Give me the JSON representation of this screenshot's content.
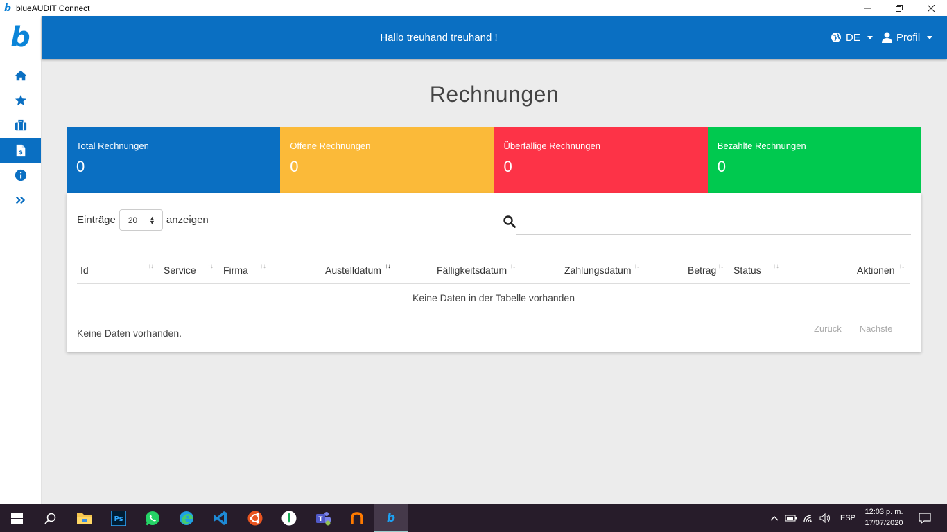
{
  "window": {
    "title": "blueAUDIT Connect",
    "logo_letter": "b"
  },
  "sidebar": {
    "brand_letter": "b",
    "items": [
      {
        "icon": "home-icon"
      },
      {
        "icon": "star-icon"
      },
      {
        "icon": "briefcase-icon"
      },
      {
        "icon": "invoice-icon",
        "active": true
      },
      {
        "icon": "info-icon"
      },
      {
        "icon": "expand-icon"
      }
    ]
  },
  "header": {
    "greeting": "Hallo treuhand treuhand !",
    "language": "DE",
    "profile": "Profil",
    "color": "#0a6fc2"
  },
  "page": {
    "title": "Rechnungen"
  },
  "stats": [
    {
      "label": "Total Rechnungen",
      "value": "0",
      "color": "#0a6fc2"
    },
    {
      "label": "Offene Rechnungen",
      "value": "0",
      "color": "#fbba39"
    },
    {
      "label": "Überfällige Rechnungen",
      "value": "0",
      "color": "#fd3347"
    },
    {
      "label": "Bezahlte Rechnungen",
      "value": "0",
      "color": "#00c94f"
    }
  ],
  "table": {
    "entries_prefix": "Einträge",
    "entries_value": "20",
    "entries_suffix": "anzeigen",
    "search_placeholder": "",
    "columns": [
      "Id",
      "Service",
      "Firma",
      "Austelldatum",
      "Fälligkeitsdatum",
      "Zahlungsdatum",
      "Betrag",
      "Status",
      "Aktionen"
    ],
    "empty_message": "Keine Daten in der Tabelle vorhanden",
    "info": "Keine Daten vorhanden.",
    "prev": "Zurück",
    "next": "Nächste"
  },
  "taskbar": {
    "apps": [
      "windows-start-icon",
      "search-icon",
      "file-explorer-icon",
      "photoshop-icon",
      "whatsapp-icon",
      "edge-icon",
      "vscode-icon",
      "ubuntu-icon",
      "mongodb-icon",
      "teams-icon",
      "orange-app-icon",
      "blueaudit-icon"
    ],
    "language": "ESP",
    "time": "12:03 p. m.",
    "date": "17/07/2020"
  }
}
